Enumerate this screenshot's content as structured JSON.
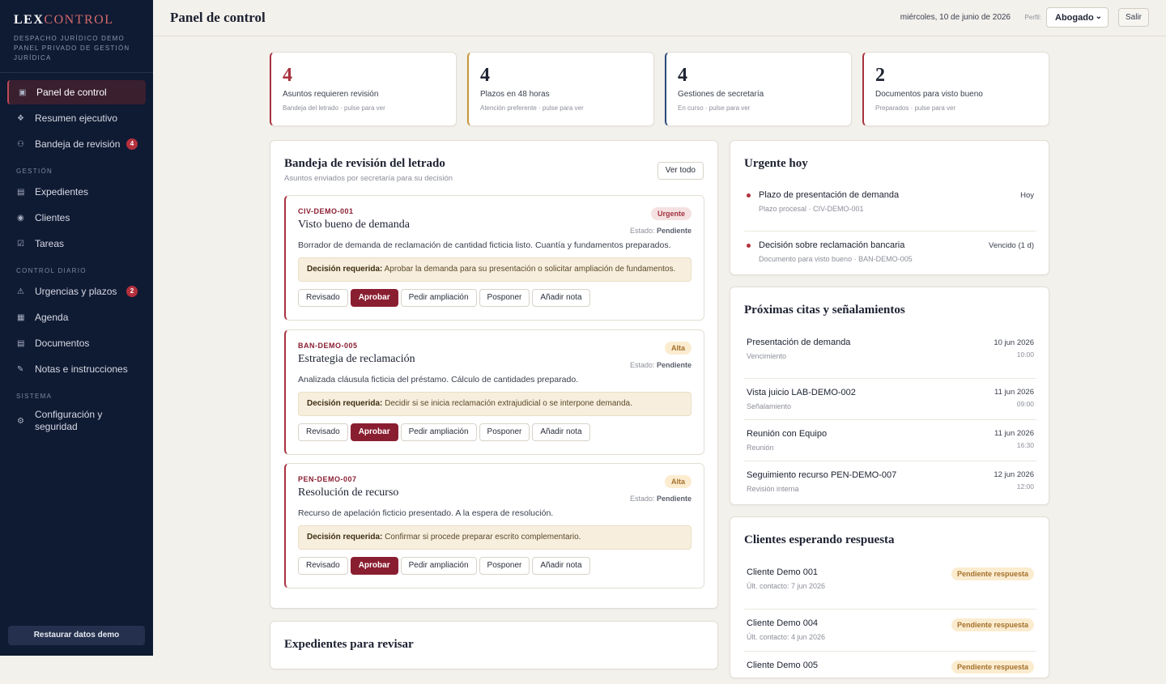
{
  "sidebar": {
    "brand_a": "LEX",
    "brand_b": "CONTROL",
    "brand_sub": [
      "DESPACHO JURÍDICO DEMO",
      "PANEL PRIVADO DE GESTIÓN",
      "JURÍDICA"
    ],
    "items": [
      {
        "label": "Panel de control",
        "icon": "dashboard-icon"
      },
      {
        "label": "Resumen ejecutivo",
        "icon": "diamond-icon"
      },
      {
        "label": "Bandeja de revisión",
        "icon": "users-icon",
        "badge": "4"
      }
    ],
    "section_gestion": "GESTIÓN",
    "gestion": [
      {
        "label": "Expedientes"
      },
      {
        "label": "Clientes"
      },
      {
        "label": "Tareas"
      }
    ],
    "section_control": "CONTROL DIARIO",
    "control": [
      {
        "label": "Urgencias y plazos",
        "badge": "2"
      },
      {
        "label": "Agenda"
      },
      {
        "label": "Documentos"
      },
      {
        "label": "Notas e instrucciones"
      }
    ],
    "section_sistema": "SISTEMA",
    "sistema": [
      {
        "label": "Configuración y seguridad"
      }
    ],
    "restore": "Restaurar datos demo"
  },
  "header": {
    "title": "Panel de control",
    "date": "miércoles, 10 de junio de 2026",
    "perfil_label": "Perfil:",
    "perfil_value": "Abogado",
    "salir": "Salir"
  },
  "kpis": [
    {
      "num": "4",
      "label": "Asuntos requieren revisión",
      "sub": "Bandeja del letrado · pulse para ver",
      "color": "#a8323f"
    },
    {
      "num": "4",
      "label": "Plazos en 48 horas",
      "sub": "Atención preferente · pulse para ver",
      "color": "#c9953a"
    },
    {
      "num": "4",
      "label": "Gestiones de secretaría",
      "sub": "En curso · pulse para ver",
      "color": "#2d4a7a"
    },
    {
      "num": "2",
      "label": "Documentos para visto bueno",
      "sub": "Preparados · pulse para ver",
      "color": "#a8323f"
    }
  ],
  "review": {
    "title": "Bandeja de revisión del letrado",
    "subtitle": "Asuntos enviados por secretaría para su decisión",
    "ver_todo": "Ver todo",
    "estado_label": "Estado:",
    "decision_label": "Decisión requerida:",
    "actions": [
      "Revisado",
      "Aprobar",
      "Pedir ampliación",
      "Posponer",
      "Añadir nota"
    ],
    "items": [
      {
        "code": "CIV-DEMO-001",
        "title": "Visto bueno de demanda",
        "tag": "Urgente",
        "estado": "Pendiente",
        "desc": "Borrador de demanda de reclamación de cantidad ficticia listo. Cuantía y fundamentos preparados.",
        "decision": "Aprobar la demanda para su presentación o solicitar ampliación de fundamentos."
      },
      {
        "code": "BAN-DEMO-005",
        "title": "Estrategia de reclamación",
        "tag": "Alta",
        "estado": "Pendiente",
        "desc": "Analizada cláusula ficticia del préstamo. Cálculo de cantidades preparado.",
        "decision": "Decidir si se inicia reclamación extrajudicial o se interpone demanda."
      },
      {
        "code": "PEN-DEMO-007",
        "title": "Resolución de recurso",
        "tag": "Alta",
        "estado": "Pendiente",
        "desc": "Recurso de apelación ficticio presentado. A la espera de resolución.",
        "decision": "Confirmar si procede preparar escrito complementario."
      }
    ]
  },
  "expedientes": {
    "title": "Expedientes para revisar"
  },
  "urgent": {
    "title": "Urgente hoy",
    "items": [
      {
        "title": "Plazo de presentación de demanda",
        "sub": "Plazo procesal · CIV-DEMO-001",
        "right": "Hoy"
      },
      {
        "title": "Decisión sobre reclamación bancaria",
        "sub": "Documento para visto bueno · BAN-DEMO-005",
        "right": "Vencido (1 d)"
      }
    ]
  },
  "citas": {
    "title": "Próximas citas y señalamientos",
    "items": [
      {
        "title": "Presentación de demanda",
        "sub": "Vencimiento",
        "date": "10 jun 2026",
        "time": "10:00"
      },
      {
        "title": "Vista juicio LAB-DEMO-002",
        "sub": "Señalamiento",
        "date": "11 jun 2026",
        "time": "09:00"
      },
      {
        "title": "Reunión con Equipo",
        "sub": "Reunión",
        "date": "11 jun 2026",
        "time": "16:30"
      },
      {
        "title": "Seguimiento recurso PEN-DEMO-007",
        "sub": "Revisión interna",
        "date": "12 jun 2026",
        "time": "12:00"
      }
    ]
  },
  "clientes": {
    "title": "Clientes esperando respuesta",
    "items": [
      {
        "name": "Cliente Demo 001",
        "sub": "Últ. contacto: 7 jun 2026",
        "status": "Pendiente respuesta"
      },
      {
        "name": "Cliente Demo 004",
        "sub": "Últ. contacto: 4 jun 2026",
        "status": "Pendiente respuesta"
      },
      {
        "name": "Cliente Demo 005",
        "sub": "",
        "status": "Pendiente respuesta"
      }
    ]
  }
}
